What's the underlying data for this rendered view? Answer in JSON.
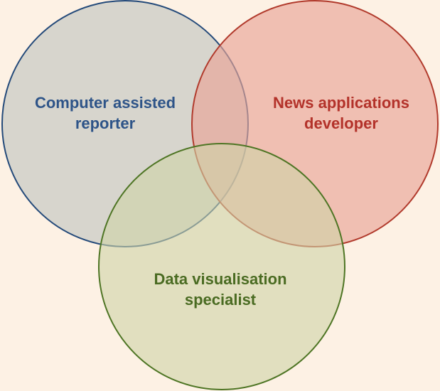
{
  "background": "#fdf1e4",
  "sets": [
    {
      "id": "car",
      "line1": "Computer assisted",
      "line2": "reporter",
      "fill": "#c9cbc6",
      "stroke": "#244a7a",
      "text_color": "#2e5488"
    },
    {
      "id": "nad",
      "line1": "News applications",
      "line2": "developer",
      "fill": "#eaa596",
      "stroke": "#b13a2c",
      "text_color": "#b3322a"
    },
    {
      "id": "dvs",
      "line1": "Data visualisation",
      "line2": "specialist",
      "fill": "#cfd4a6",
      "stroke": "#4e7524",
      "text_color": "#4a6b22"
    }
  ]
}
